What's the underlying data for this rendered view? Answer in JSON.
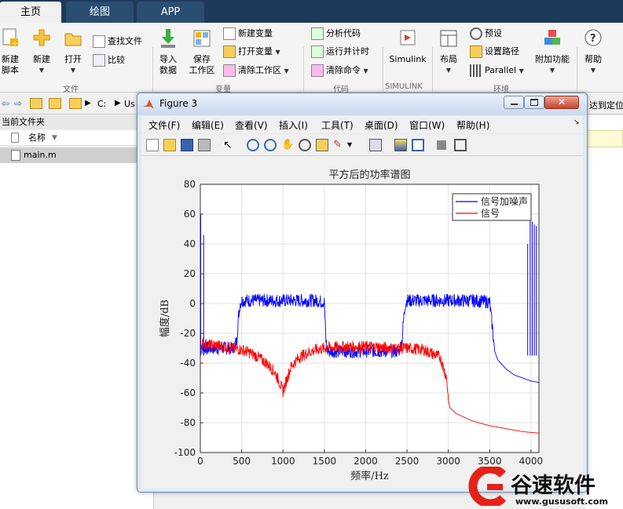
{
  "tabs": {
    "home": "主页",
    "plots": "绘图",
    "apps": "APP"
  },
  "ribbon": {
    "new_script": "新建\n脚本",
    "new_script_l1": "新建",
    "new_script_l2": "脚本",
    "new": "新建",
    "open": "打开",
    "find_files": "查找文件",
    "compare": "比较",
    "import_l1": "导入",
    "import_l2": "数据",
    "save_ws_l1": "保存",
    "save_ws_l2": "工作区",
    "new_var": "新建变量",
    "open_var": "打开变量",
    "clear_ws": "清除工作区",
    "analyze_code": "分析代码",
    "run_time": "运行并计时",
    "clear_cmd": "清除命令",
    "simulink": "Simulink",
    "layout": "布局",
    "prefs": "预设",
    "set_path": "设置路径",
    "parallel": "Parallel",
    "addons": "附加功能",
    "help": "帮助",
    "groups": {
      "file": "文件",
      "variable": "变量",
      "code": "代码",
      "simulink": "SIMULINK",
      "env": "环境"
    }
  },
  "pathbar": {
    "drive": "C:",
    "seg": "Us",
    "right_text": "达到定位"
  },
  "file_browser": {
    "title": "当前文件夹",
    "col_name": "名称",
    "file": "main.m"
  },
  "figure": {
    "title": "Figure 3",
    "menus": [
      "文件(F)",
      "编辑(E)",
      "查看(V)",
      "插入(I)",
      "工具(T)",
      "桌面(D)",
      "窗口(W)",
      "帮助(H)"
    ]
  },
  "chart_data": {
    "type": "line",
    "title": "平方后的功率谱图",
    "xlabel": "频率/Hz",
    "ylabel": "幅度/dB",
    "xlim": [
      0,
      4096
    ],
    "ylim": [
      -100,
      80
    ],
    "xticks": [
      0,
      500,
      1000,
      1500,
      2000,
      2500,
      3000,
      3500,
      4000
    ],
    "yticks": [
      -100,
      -80,
      -60,
      -40,
      -20,
      0,
      20,
      40,
      60,
      80
    ],
    "grid": true,
    "legend_position": "top-right",
    "series": [
      {
        "name": "信号加噪声",
        "color": "#0000ff",
        "x": [
          0,
          10,
          20,
          50,
          100,
          200,
          300,
          400,
          440,
          460,
          480,
          500,
          600,
          800,
          1000,
          1200,
          1400,
          1500,
          1520,
          1540,
          1600,
          1800,
          2000,
          2200,
          2400,
          2440,
          2460,
          2480,
          2500,
          2700,
          2900,
          3100,
          3300,
          3500,
          3540,
          3560,
          3600,
          3700,
          3800,
          3900,
          4000,
          4096
        ],
        "y": [
          -25,
          -28,
          -30,
          -30,
          -30,
          -30,
          -30,
          -30,
          -25,
          -10,
          0,
          2,
          2,
          2,
          2,
          2,
          2,
          1,
          -25,
          -32,
          -32,
          -32,
          -32,
          -32,
          -32,
          -25,
          -10,
          0,
          2,
          2,
          2,
          2,
          2,
          1,
          -20,
          -32,
          -38,
          -44,
          -48,
          -50,
          -52,
          -53
        ]
      },
      {
        "name": "信号",
        "color": "#ff0000",
        "x": [
          0,
          50,
          100,
          200,
          300,
          400,
          500,
          600,
          700,
          800,
          900,
          950,
          1000,
          1050,
          1100,
          1200,
          1300,
          1400,
          1500,
          1700,
          1900,
          2100,
          2300,
          2500,
          2700,
          2900,
          2980,
          3000,
          3020,
          3100,
          3300,
          3500,
          3700,
          3900,
          4096
        ],
        "y": [
          -27,
          -27,
          -28,
          -28,
          -29,
          -30,
          -31,
          -33,
          -36,
          -40,
          -46,
          -52,
          -59,
          -50,
          -42,
          -36,
          -33,
          -31,
          -30,
          -29,
          -29,
          -29,
          -30,
          -30,
          -31,
          -36,
          -50,
          -65,
          -70,
          -74,
          -79,
          -82,
          -84,
          -86,
          -87
        ]
      }
    ],
    "spikes_blue": [
      {
        "x": 5,
        "y": 60
      },
      {
        "x": 40,
        "y": 46
      },
      {
        "x": 3960,
        "y": 40
      },
      {
        "x": 3990,
        "y": 58
      },
      {
        "x": 4015,
        "y": 55
      },
      {
        "x": 4040,
        "y": 53
      },
      {
        "x": 4065,
        "y": 52
      }
    ]
  },
  "watermark": {
    "name": "谷速软件",
    "url": "www.gususoft.com"
  }
}
